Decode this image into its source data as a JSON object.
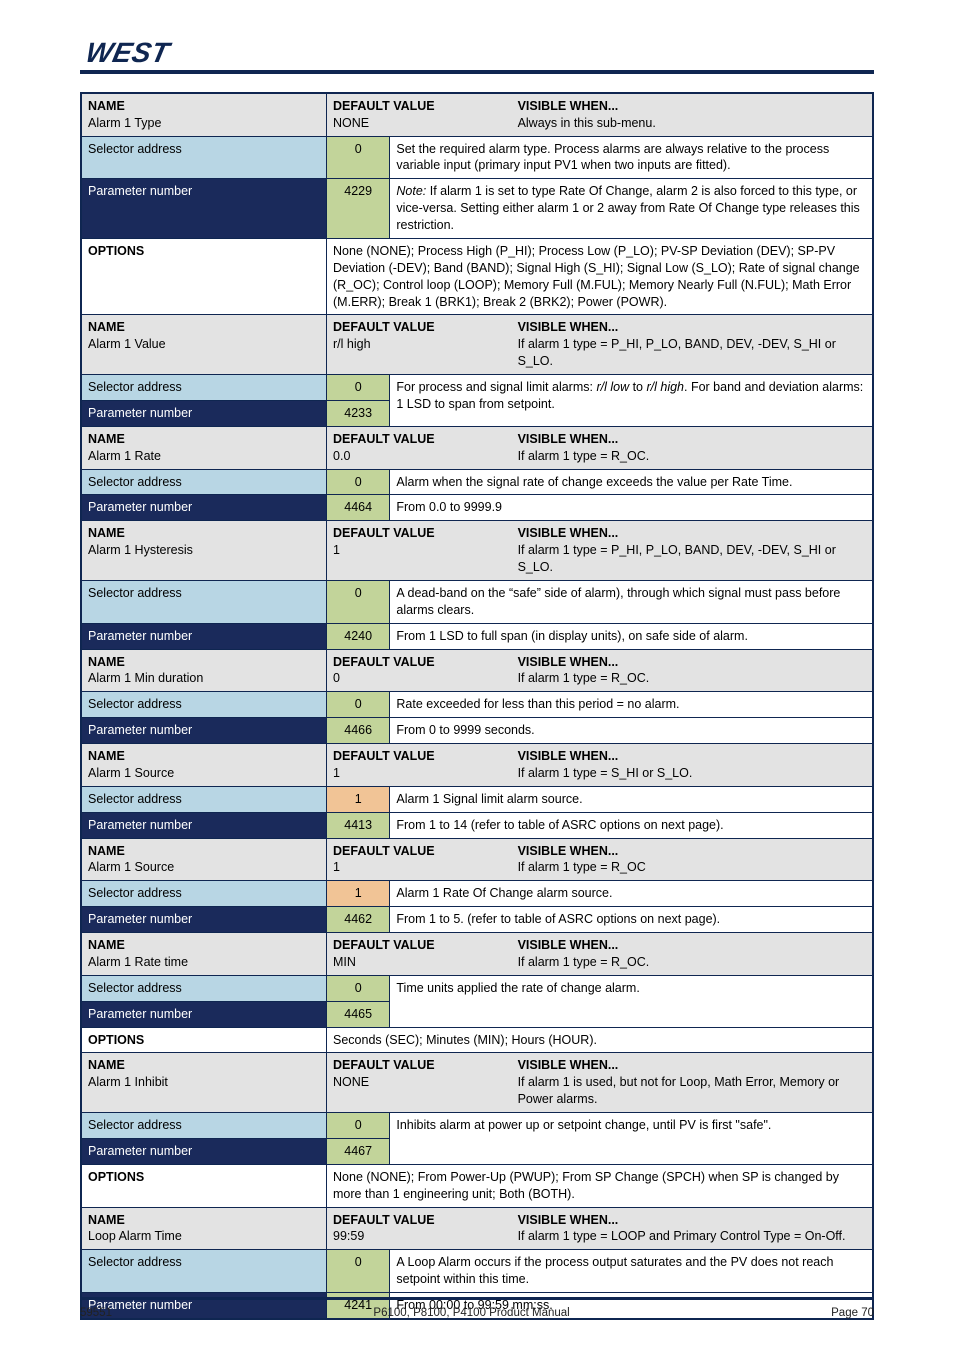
{
  "header": {
    "logo_text": "WEST"
  },
  "footer": {
    "doc_id": "59551",
    "title": "P6100, P8100, P4100 Product Manual",
    "page": "Page 70"
  },
  "rows": [
    {
      "hdr": {
        "name": "Alarm 1 Type",
        "default": "NONE",
        "vis": "Always in this sub-menu."
      },
      "r1": {
        "label": "Selector address",
        "val": "0",
        "desc_html": "Set the required alarm type. Process alarms are always relative to the process variable input (primary input PV1 when two inputs are fitted)."
      },
      "r2": {
        "label": "Parameter number",
        "val": "4229",
        "desc_html": "<i>Note:</i> If alarm 1 is set to type Rate Of Change, alarm 2 is also forced to this type, or vice-versa. Setting either alarm&nbsp;1 or 2 away from Rate Of Change type releases this restriction."
      },
      "options": {
        "title": "OPTIONS",
        "list_html": "None (NONE); Process High (P_HI); Process Low (P_LO); PV-SP Deviation (DEV); SP-PV Deviation (-DEV); Band (BAND); Signal High (S_HI); Signal Low (S_LO); Rate of signal change (R_OC); Control loop (LOOP); Memory Full (M.FUL); Memory Nearly Full (N.FUL); Math Error (M.ERR); Break 1 (BRK1); Break 2 (BRK2); Power (POWR)."
      }
    },
    {
      "hdr": {
        "name": "Alarm 1 Value",
        "default": "r/l high",
        "vis": "If alarm 1 type = P_HI, P_LO, BAND, DEV, -DEV, S_HI or S_LO."
      },
      "r1": {
        "label": "Selector address",
        "val": "0",
        "desc_html": "For process and signal limit alarms: <i>r/l low</i> to <i>r/l high</i>. For band and deviation alarms: 1 LSD to span from setpoint."
      },
      "r2": {
        "label": "Parameter number",
        "val": "4233",
        "desc_html": ""
      }
    },
    {
      "hdr": {
        "name": "Alarm 1 Rate",
        "default": "0.0",
        "vis": "If alarm 1 type = R_OC."
      },
      "r1": {
        "label": "Selector address",
        "val": "0",
        "desc_html": "Alarm when the signal rate of change exceeds the value per Rate Time."
      },
      "r2": {
        "label": "Parameter number",
        "val": "4464",
        "desc_html": "From 0.0 to 9999.9"
      }
    },
    {
      "hdr": {
        "name": "Alarm 1 Hysteresis",
        "default": "1",
        "vis": "If alarm 1 type = P_HI, P_LO, BAND, DEV, -DEV, S_HI or S_LO."
      },
      "r1": {
        "label": "Selector address",
        "val": "0",
        "desc_html": "A dead-band on the “safe” side of alarm), through which signal must pass before alarms clears."
      },
      "r2": {
        "label": "Parameter number",
        "val": "4240",
        "desc_html": "From 1 LSD to full span (in display units), on safe side of alarm."
      }
    },
    {
      "hdr": {
        "name": "Alarm 1 Min duration",
        "default": "0",
        "vis": "If alarm 1 type = R_OC."
      },
      "r1": {
        "label": "Selector address",
        "val": "0",
        "desc_html": "Rate exceeded for less than this period = no alarm."
      },
      "r2": {
        "label": "Parameter number",
        "val": "4466",
        "desc_html": "From 0 to 9999 seconds."
      }
    },
    {
      "hdr": {
        "name": "Alarm 1 Source",
        "default": "1",
        "vis": "If alarm 1 type = S_HI or S_LO."
      },
      "r1": {
        "label": "Selector address",
        "val": "1",
        "desc_html": "Alarm 1 Signal limit alarm source."
      },
      "r2": {
        "label": "Parameter number",
        "val": "4413",
        "desc_html": "From 1 to 14 (refer to table of ASRC options on next page)."
      }
    },
    {
      "hdr": {
        "name": "Alarm 1 Source",
        "default": "1",
        "vis": "If alarm 1 type = R_OC"
      },
      "r1": {
        "label": "Selector address",
        "val": "1",
        "desc_html": "Alarm 1 Rate Of Change alarm source."
      },
      "r2": {
        "label": "Parameter number",
        "val": "4462",
        "desc_html": "From 1 to 5. (refer to table of ASRC options on next page)."
      }
    },
    {
      "hdr": {
        "name": "Alarm 1 Rate time",
        "default": "MIN",
        "vis": "If alarm 1 type = R_OC."
      },
      "r1": {
        "label": "Selector address",
        "val": "0",
        "desc_html": "Time units applied the rate of change alarm."
      },
      "r2": {
        "label": "Parameter number",
        "val": "4465",
        "desc_html": ""
      },
      "options": {
        "title": "OPTIONS",
        "list_html": "Seconds (SEC); Minutes (MIN); Hours (HOUR)."
      }
    },
    {
      "hdr": {
        "name": "Alarm 1 Inhibit",
        "default": "NONE",
        "vis": "If alarm 1 is used, but not for Loop, Math Error, Memory or Power alarms."
      },
      "r1": {
        "label": "Selector address",
        "val": "0",
        "desc_html": "Inhibits alarm at power up or setpoint change, until PV is first \"safe\"."
      },
      "r2": {
        "label": "Parameter number",
        "val": "4467",
        "desc_html": ""
      },
      "options": {
        "title": "OPTIONS",
        "list_html": "None (NONE); From Power-Up (PWUP); From SP Change (SPCH) when SP is changed by more than 1 engineering unit; Both (BOTH)."
      }
    },
    {
      "hdr": {
        "name": "Loop Alarm Time",
        "default": "99:59",
        "vis": "If alarm 1 type = LOOP and Primary Control Type = On-Off."
      },
      "r1": {
        "label": "Selector address",
        "val": "0",
        "desc_html": "A Loop Alarm occurs if the process output saturates and the PV does not reach setpoint within this time."
      },
      "r2": {
        "label": "Parameter number",
        "val": "4241",
        "desc_html": "From 00:00 to 99:59 mm:ss."
      }
    }
  ],
  "labels": {
    "name": "NAME",
    "default_value": "DEFAULT VALUE",
    "visible_when": "VISIBLE WHEN..."
  }
}
